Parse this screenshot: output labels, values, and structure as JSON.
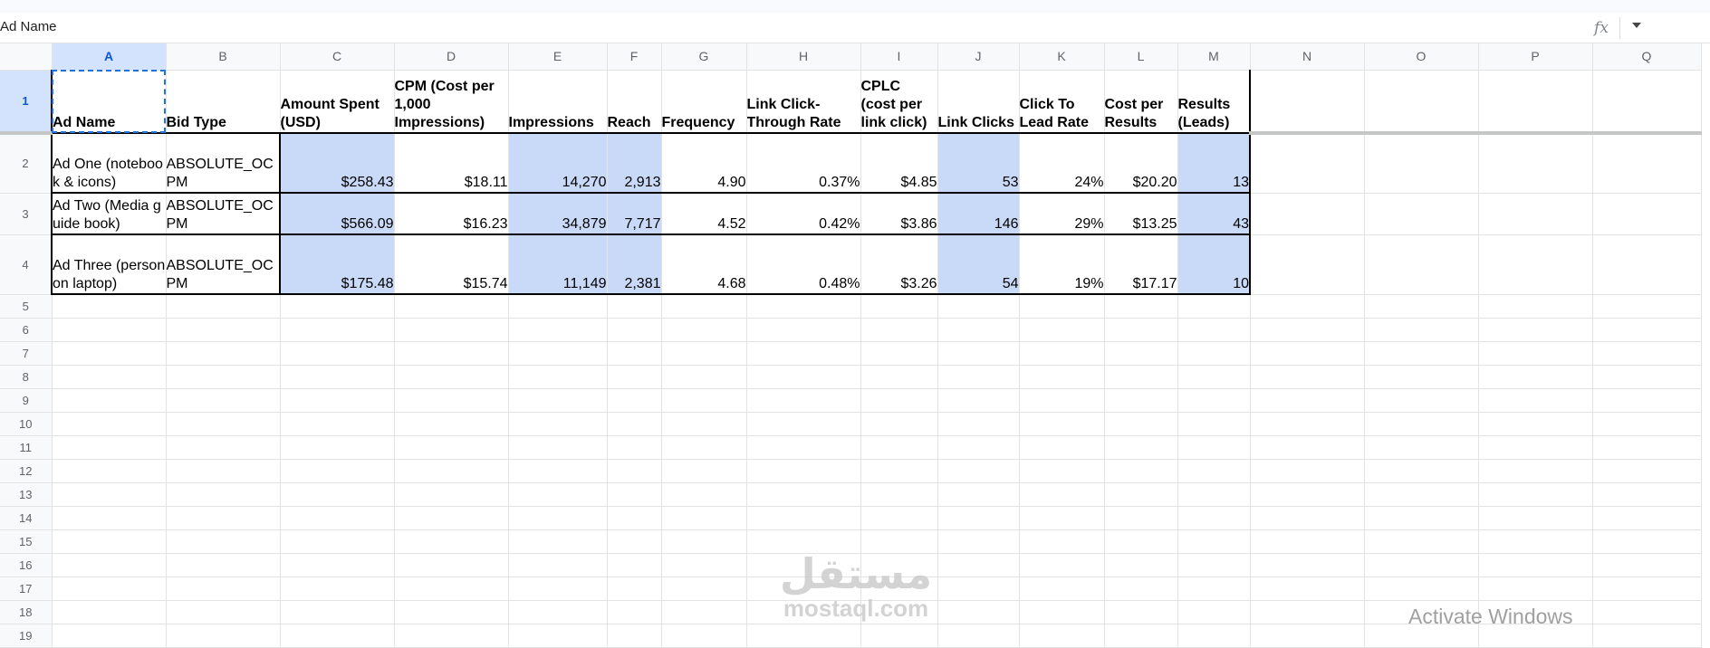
{
  "formula_bar": {
    "name_box": "Ad Name",
    "fx": "fx"
  },
  "columns": [
    "A",
    "B",
    "C",
    "D",
    "E",
    "F",
    "G",
    "H",
    "I",
    "J",
    "K",
    "L",
    "M",
    "N",
    "O",
    "P",
    "Q"
  ],
  "row_numbers": [
    "1",
    "2",
    "3",
    "4",
    "5",
    "6",
    "7",
    "8",
    "9",
    "10",
    "11",
    "12",
    "13",
    "14",
    "15",
    "16",
    "17",
    "18",
    "19"
  ],
  "headers": [
    "Ad Name",
    "Bid Type",
    "Amount Spent (USD)",
    "CPM (Cost per 1,000 Impressions)",
    "Impressions",
    "Reach",
    "Frequency",
    "Link Click-Through Rate",
    "CPLC (cost per link click)",
    "Link Clicks",
    "Click To Lead Rate",
    "Cost per Results",
    "Results (Leads)"
  ],
  "rows": [
    [
      "Ad One (notebook & icons)",
      "ABSOLUTE_OCPM",
      "$258.43",
      "$18.11",
      "14,270",
      "2,913",
      "4.90",
      "0.37%",
      "$4.85",
      "53",
      "24%",
      "$20.20",
      "13"
    ],
    [
      "Ad Two (Media guide book)",
      "ABSOLUTE_OCPM",
      "$566.09",
      "$16.23",
      "34,879",
      "7,717",
      "4.52",
      "0.42%",
      "$3.86",
      "146",
      "29%",
      "$13.25",
      "43"
    ],
    [
      "Ad Three (person on laptop)",
      "ABSOLUTE_OCPM",
      "$175.48",
      "$15.74",
      "11,149",
      "2,381",
      "4.68",
      "0.48%",
      "$3.26",
      "54",
      "19%",
      "$17.17",
      "10"
    ]
  ],
  "highlight_color": "#c9daf8",
  "selection_color": "#1a73e8",
  "watermark": {
    "arabic": "مستقل",
    "latin": "mostaql.com"
  },
  "os_notice": "Activate Windows"
}
